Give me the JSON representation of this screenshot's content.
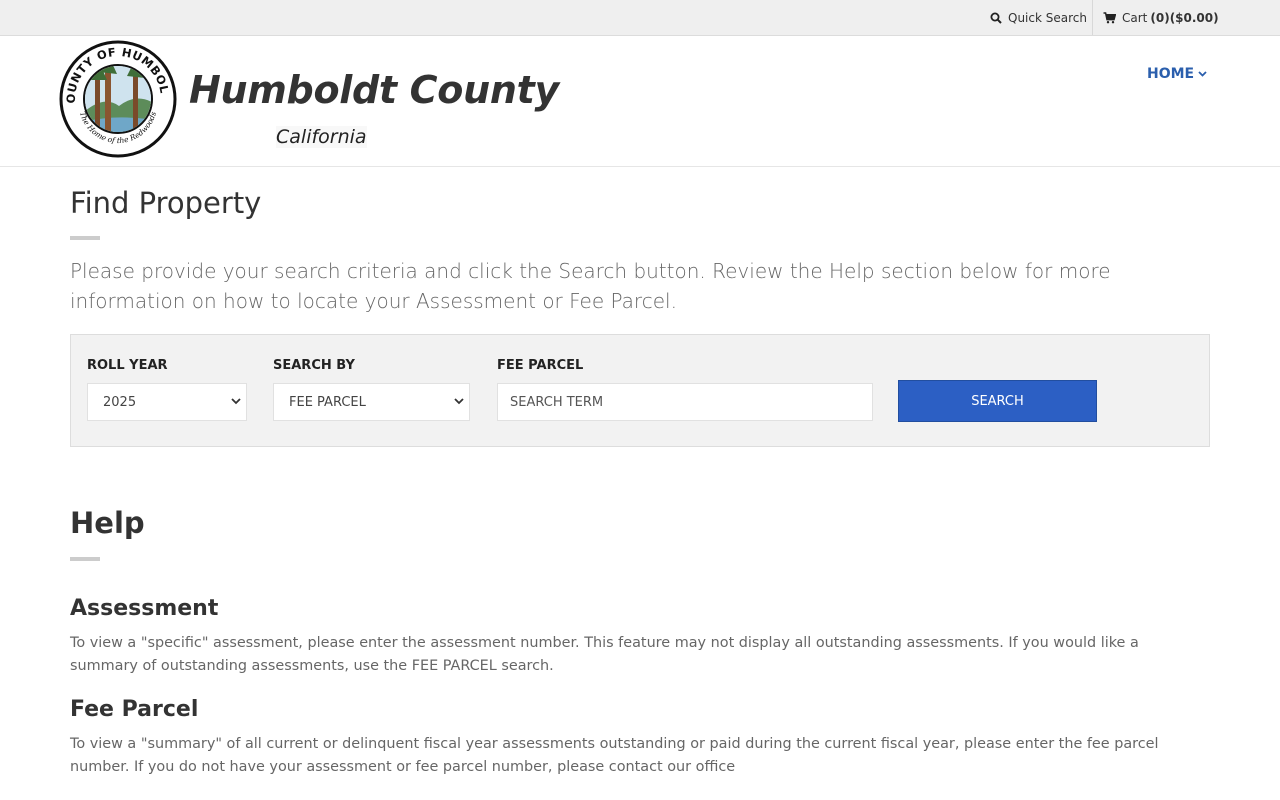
{
  "utility_bar": {
    "quick_search_label": "Quick Search",
    "cart_label": "Cart",
    "cart_summary": "(0)($0.00)"
  },
  "header": {
    "county_name": "Humboldt County",
    "state_name": "California",
    "seal_text_top": "COUNTY OF HUMBOLDT",
    "seal_text_bottom": "The Home of the Redwoods",
    "nav_home_label": "HOME"
  },
  "page": {
    "title": "Find Property",
    "intro": "Please provide your search criteria and click the Search button. Review the Help section below for more information on how to locate your Assessment or Fee Parcel."
  },
  "search_form": {
    "roll_year_label": "ROLL YEAR",
    "roll_year_value": "2025",
    "search_by_label": "SEARCH BY",
    "search_by_value": "FEE PARCEL",
    "term_label": "FEE PARCEL",
    "term_placeholder": "SEARCH TERM",
    "search_button_label": "SEARCH"
  },
  "help": {
    "title": "Help",
    "sections": [
      {
        "heading": "Assessment",
        "text": "To view a \"specific\" assessment, please enter the assessment number. This feature may not display all outstanding assessments. If you would like a summary of outstanding assessments, use the FEE PARCEL search."
      },
      {
        "heading": "Fee Parcel",
        "text": "To view a \"summary\" of all current or delinquent fiscal year assessments outstanding or paid during the current fiscal year, please enter the fee parcel number. If you do not have your assessment or fee parcel number, please contact our office"
      }
    ]
  },
  "colors": {
    "accent_blue": "#2c5fc4",
    "nav_blue": "#2b5fad",
    "topbar_bg": "#efefef",
    "panel_bg": "#f2f2f2"
  },
  "icons": {
    "quick_search": "search-icon",
    "cart": "shopping-cart-icon",
    "home_nav": "chevron-down-icon",
    "select": "chevron-down-icon"
  }
}
